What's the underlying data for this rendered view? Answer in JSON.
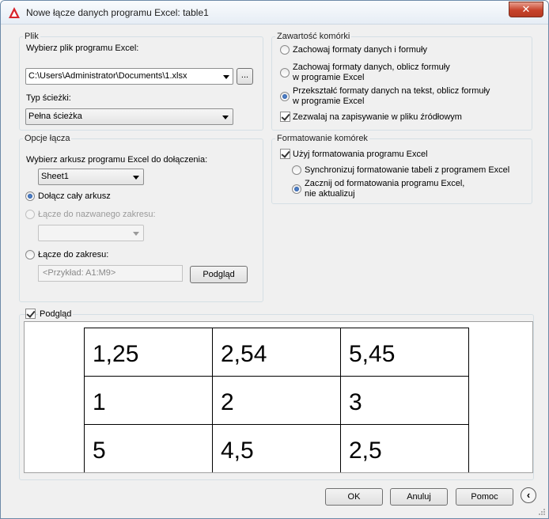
{
  "window": {
    "title": "Nowe łącze danych programu Excel: table1",
    "close": "✕"
  },
  "plik": {
    "legend": "Plik",
    "choose_label": "Wybierz plik programu Excel:",
    "file_value": "C:\\Users\\Administrator\\Documents\\1.xlsx",
    "browse_label": "...",
    "path_type_label": "Typ ścieżki:",
    "path_type_value": "Pełna ścieżka"
  },
  "link": {
    "legend": "Opcje łącza",
    "sheet_label": "Wybierz arkusz programu Excel do dołączenia:",
    "sheet_value": "Sheet1",
    "opt_whole_sheet": "Dołącz cały arkusz",
    "opt_named_range": "Łącze do nazwanego zakresu:",
    "named_range_value": "",
    "opt_range": "Łącze do zakresu:",
    "range_placeholder": "<Przykład: A1:M9>",
    "preview_button": "Podgląd"
  },
  "cell": {
    "legend": "Zawartość komórki",
    "opt1": "Zachowaj formaty danych i formuły",
    "opt2_line1": "Zachowaj formaty danych, oblicz formuły",
    "opt2_line2": "w programie Excel",
    "opt3_line1": "Przekształć formaty danych na tekst, oblicz formuły",
    "opt3_line2": "w programie Excel",
    "allow_write": "Zezwalaj na zapisywanie w pliku źródłowym"
  },
  "format": {
    "legend": "Formatowanie komórek",
    "use_excel": "Użyj formatowania programu Excel",
    "sync": "Synchronizuj formatowanie tabeli z programem Excel",
    "start_line1": "Zacznij od formatowania programu Excel,",
    "start_line2": "nie aktualizuj"
  },
  "preview": {
    "label": "Podgląd",
    "rows": [
      [
        "1,25",
        "2,54",
        "5,45"
      ],
      [
        "1",
        "2",
        "3"
      ],
      [
        "5",
        "4,5",
        "2,5"
      ]
    ]
  },
  "buttons": {
    "ok": "OK",
    "cancel": "Anuluj",
    "help": "Pomoc"
  },
  "icons": {
    "app": "autocad-logo-icon",
    "collapse": "chevron-left-circle-icon"
  }
}
